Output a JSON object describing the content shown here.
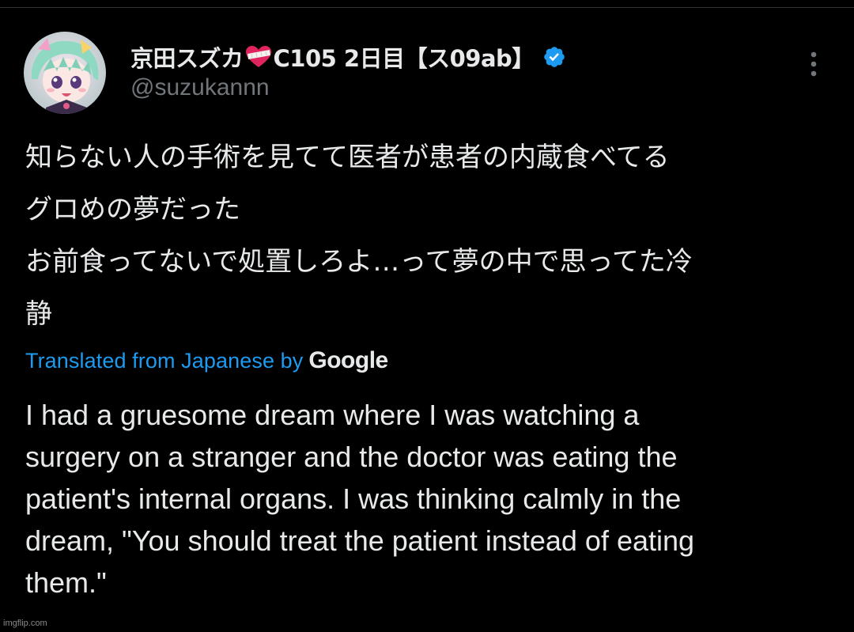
{
  "tweet": {
    "author": {
      "display_name": "京田スズカ",
      "name_suffix": "C105 2日目【ス09ab】",
      "handle": "@suzukannn",
      "verified": true
    },
    "original_text_lines": [
      "知らない人の手術を見てて医者が患者の内蔵食べてる",
      "グロめの夢だった",
      "お前食ってないで処置しろよ…って夢の中で思ってた冷",
      "静"
    ],
    "translation": {
      "link_text": "Translated from Japanese by",
      "provider": "Google"
    },
    "translated_text_lines": [
      "I had a gruesome dream where I was watching a",
      "surgery on a stranger and the doctor was eating the",
      "patient's internal organs. I was thinking calmly in the",
      "dream, \"You should treat the patient instead of eating",
      "them.\""
    ]
  },
  "watermark": "imgflip.com",
  "colors": {
    "background": "#000000",
    "text_primary": "#e7e9ea",
    "text_secondary": "#71767b",
    "accent": "#1d9bf0",
    "heart": "#e0245e"
  },
  "icons": {
    "heart": "bandaged-heart-icon",
    "verified": "verified-badge-icon",
    "more": "more-vertical-icon",
    "avatar": "avatar"
  }
}
